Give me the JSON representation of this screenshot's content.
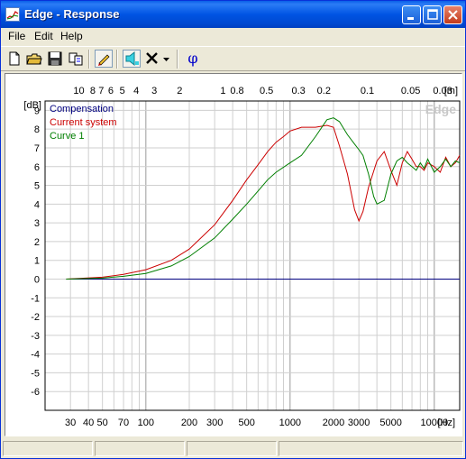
{
  "window": {
    "title": "Edge - Response"
  },
  "menu": [
    {
      "label": "File"
    },
    {
      "label": "Edit"
    },
    {
      "label": "Help"
    }
  ],
  "toolbar": {
    "tools": [
      "new-file-icon",
      "open-folder-icon",
      "save-icon",
      "copy-icon",
      "pencil-icon",
      "speaker-icon",
      "delete-icon",
      "dropdown-arrow-icon",
      "phi-icon"
    ],
    "phi_label": "φ"
  },
  "chart_data": {
    "type": "line",
    "watermark": "Edge",
    "xscale": "log",
    "xlim": [
      20,
      15000
    ],
    "ylim": [
      -7,
      9.5
    ],
    "ylabel": "[dB]",
    "xunit": "[Hz]",
    "top_axis_unit": "[m]",
    "yticks": [
      9,
      8,
      7,
      6,
      5,
      4,
      3,
      2,
      1,
      0,
      -1,
      -2,
      -3,
      -4,
      -5,
      -6
    ],
    "xtick_labels": [
      "30",
      "40",
      "50",
      "70",
      "100",
      "200",
      "300",
      "500",
      "1000",
      "2000",
      "3000",
      "5000",
      "10000"
    ],
    "top_tick_labels": [
      "10",
      "8",
      "7",
      "6",
      "5",
      "4",
      "3",
      "2",
      "1",
      "0.8",
      "0.5",
      "0.3",
      "0.2",
      "0.1",
      "0.05",
      "0.03"
    ],
    "series": [
      {
        "name": "Compensation",
        "color": "#00007f",
        "x": [
          28,
          15000
        ],
        "y": [
          0,
          0
        ]
      },
      {
        "name": "Current system",
        "color": "#cc0000",
        "x": [
          28,
          50,
          70,
          100,
          150,
          200,
          300,
          400,
          500,
          600,
          700,
          800,
          900,
          1000,
          1200,
          1500,
          1800,
          2000,
          2200,
          2500,
          2800,
          3000,
          3200,
          3500,
          4000,
          4500,
          5000,
          5500,
          6000,
          6500,
          7000,
          7500,
          8000,
          8500,
          9000,
          10000,
          11000,
          12000,
          13000,
          14000,
          15000
        ],
        "y": [
          0,
          0.1,
          0.25,
          0.5,
          1.0,
          1.6,
          2.9,
          4.2,
          5.3,
          6.1,
          6.8,
          7.3,
          7.6,
          7.9,
          8.1,
          8.1,
          8.2,
          8.1,
          7.1,
          5.6,
          3.7,
          3.1,
          3.6,
          4.9,
          6.3,
          6.8,
          5.8,
          5.0,
          6.2,
          6.8,
          6.4,
          6.0,
          6.0,
          5.8,
          6.2,
          6.0,
          5.7,
          6.5,
          6.0,
          6.2,
          6.6
        ]
      },
      {
        "name": "Curve 1",
        "color": "#007f00",
        "x": [
          28,
          50,
          70,
          100,
          150,
          200,
          300,
          400,
          500,
          600,
          700,
          800,
          1000,
          1200,
          1500,
          1800,
          2000,
          2200,
          2500,
          2800,
          3000,
          3200,
          3500,
          3800,
          4000,
          4500,
          5000,
          5500,
          6000,
          6500,
          7000,
          7500,
          8000,
          8500,
          9000,
          10000,
          11000,
          12000,
          13000,
          14000,
          15000
        ],
        "y": [
          0,
          0.05,
          0.15,
          0.3,
          0.7,
          1.2,
          2.2,
          3.2,
          4.0,
          4.7,
          5.3,
          5.7,
          6.2,
          6.6,
          7.6,
          8.5,
          8.6,
          8.4,
          7.7,
          7.2,
          6.9,
          6.6,
          5.6,
          4.4,
          4.0,
          4.2,
          5.6,
          6.3,
          6.5,
          6.2,
          6.0,
          5.8,
          6.2,
          5.9,
          6.4,
          5.7,
          6.0,
          6.4,
          6.0,
          6.3,
          6.2
        ]
      }
    ]
  }
}
